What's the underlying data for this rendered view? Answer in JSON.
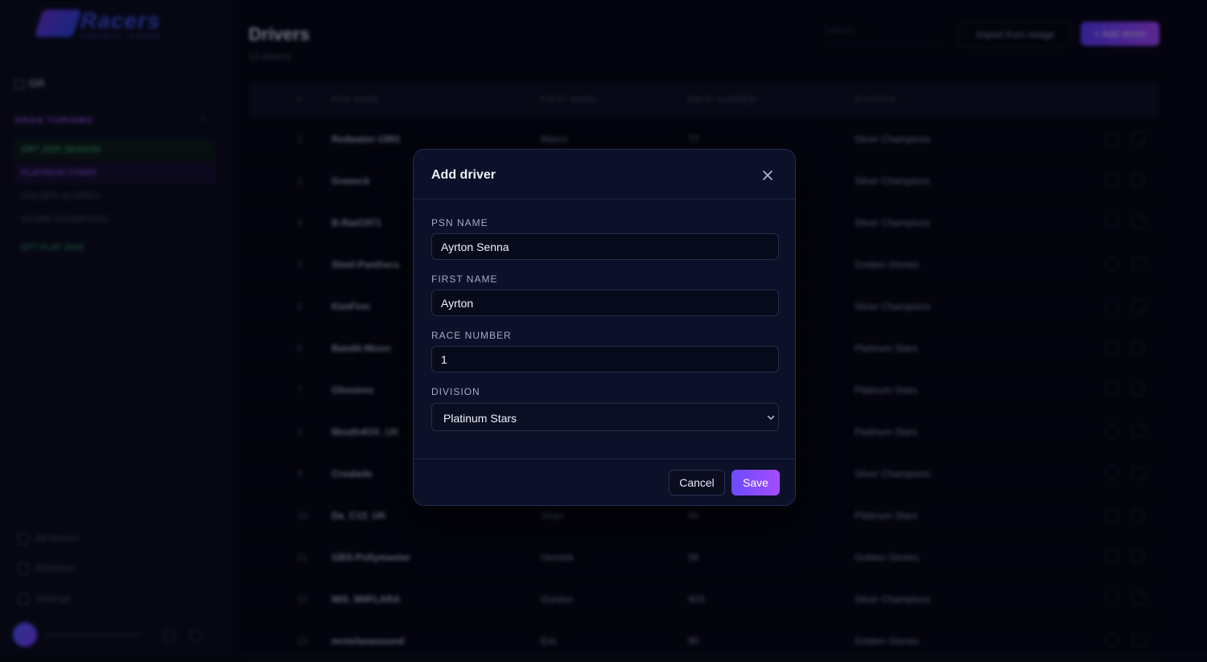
{
  "app": {
    "logo_word": "Racers",
    "logo_sub": "ESPORTS LEAGUE",
    "sidebar_top_label": "GR",
    "section_label": "GRAN TURISMO",
    "sidebar_items": [
      {
        "label": "GR7 2025 SEASON",
        "style": "green"
      },
      {
        "label": "PLATINUM STARS",
        "style": "purple"
      },
      {
        "label": "GOLDEN GLORIES",
        "style": "grey"
      },
      {
        "label": "SILVER CHAMPIONS",
        "style": "grey"
      },
      {
        "label": "GT7 FLAT 2025",
        "style": "green2"
      }
    ],
    "sidebar_footer": [
      "All Drivers",
      "Statistics",
      "Settings"
    ],
    "page_title": "Drivers",
    "page_subtitle": "13 drivers",
    "search_placeholder": "Search...",
    "import_label": "Import from image",
    "add_label": "+ Add driver",
    "columns": [
      "#",
      "PSN NAME",
      "FIRST NAME",
      "RACE NUMBER",
      "DIVISION"
    ],
    "rows": [
      {
        "rank": "1",
        "psn": "Redwater-1993",
        "first": "Marco",
        "num": "77",
        "division": "Silver Champions"
      },
      {
        "rank": "2",
        "psn": "Greeeck",
        "first": "",
        "num": "",
        "division": "Silver Champions"
      },
      {
        "rank": "3",
        "psn": "B-Rad1971",
        "first": "",
        "num": "",
        "division": "Silver Champions"
      },
      {
        "rank": "4",
        "psn": "Steel-Panthera",
        "first": "",
        "num": "",
        "division": "Golden Glories"
      },
      {
        "rank": "5",
        "psn": "KimFinn",
        "first": "",
        "num": "",
        "division": "Silver Champions"
      },
      {
        "rank": "6",
        "psn": "Bandit-Moon",
        "first": "",
        "num": "",
        "division": "Platinum Stars"
      },
      {
        "rank": "7",
        "psn": "Ghostrex",
        "first": "",
        "num": "",
        "division": "Platinum Stars"
      },
      {
        "rank": "8",
        "psn": "Mouth4OX_UK",
        "first": "",
        "num": "",
        "division": "Platinum Stars"
      },
      {
        "rank": "9",
        "psn": "Crealade",
        "first": "",
        "num": "",
        "division": "Silver Champions"
      },
      {
        "rank": "10",
        "psn": "Da_C13_UK",
        "first": "Sean",
        "num": "44",
        "division": "Platinum Stars"
      },
      {
        "rank": "11",
        "psn": "GBS-Pollymaster",
        "first": "Hendrik",
        "num": "58",
        "division": "Golden Glories"
      },
      {
        "rank": "12",
        "psn": "MIS_M0FLARA",
        "first": "Gordon",
        "num": "403",
        "division": "Silver Champions"
      },
      {
        "rank": "13",
        "psn": "mrmrlasasound",
        "first": "Eric",
        "num": "90",
        "division": "Golden Glories"
      }
    ]
  },
  "modal": {
    "title": "Add driver",
    "fields": {
      "psn_name": {
        "label": "PSN NAME",
        "value": "Ayrton Senna"
      },
      "first_name": {
        "label": "FIRST NAME",
        "value": "Ayrton"
      },
      "race_number": {
        "label": "RACE NUMBER",
        "value": "1"
      },
      "division": {
        "label": "DIVISION",
        "value": "Platinum Stars"
      }
    },
    "cancel_label": "Cancel",
    "save_label": "Save"
  },
  "colors": {
    "accent": "#7b4cff",
    "save_gradient_start": "#6a4cff",
    "save_gradient_end": "#a64cff",
    "modal_bg": "#0c1129",
    "page_bg": "#05060f"
  }
}
